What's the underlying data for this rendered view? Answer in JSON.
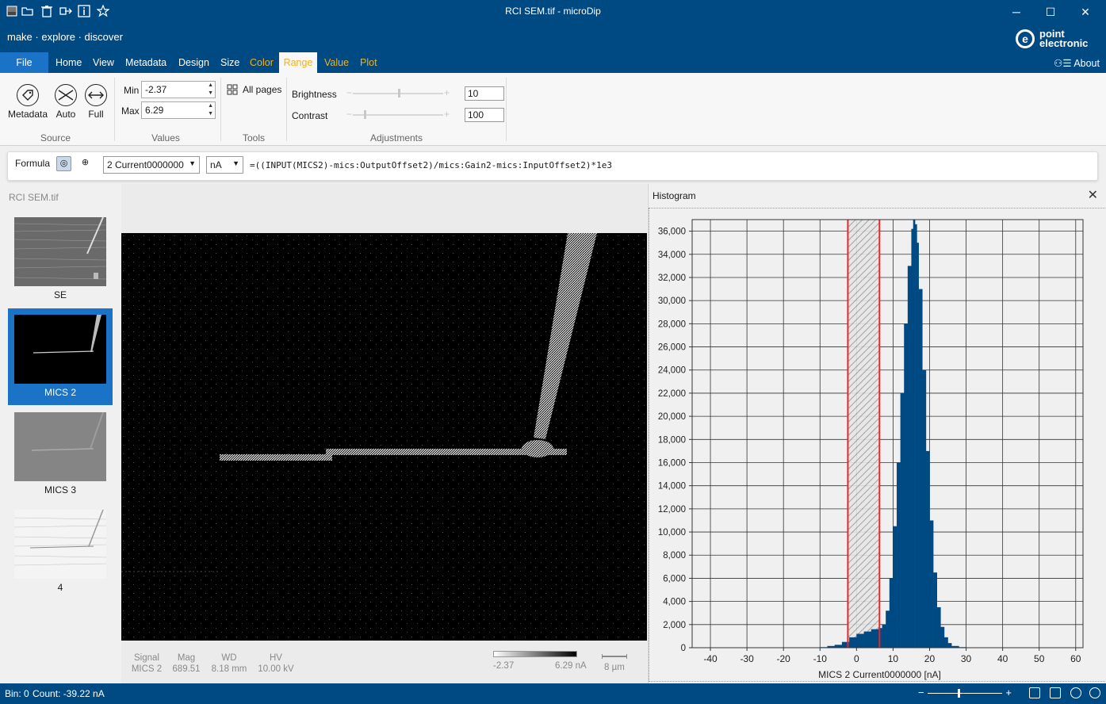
{
  "window": {
    "title": "RCI SEM.tif - microDip",
    "quick_access": [
      "image-icon",
      "open-folder-icon",
      "delete-icon",
      "export-icon",
      "info-icon",
      "star-icon"
    ],
    "controls": {
      "minimize": "─",
      "maximize": "☐",
      "close": "✕"
    }
  },
  "banner": {
    "tagline": "make · explore · discover",
    "logo_line1": "point",
    "logo_line2": "electronic",
    "logo_glyph": "e"
  },
  "tabs": [
    {
      "label": "File"
    },
    {
      "label": "Home"
    },
    {
      "label": "View"
    },
    {
      "label": "Metadata"
    },
    {
      "label": "Design"
    },
    {
      "label": "Size"
    },
    {
      "label": "Color"
    },
    {
      "label": "Range"
    },
    {
      "label": "Value"
    },
    {
      "label": "Plot"
    }
  ],
  "about": "⚇☰ About",
  "ribbon": {
    "source": {
      "label": "Source",
      "buttons": [
        {
          "label": "Metadata",
          "icon": "tag-icon"
        },
        {
          "label": "Auto",
          "icon": "auto-range-icon"
        },
        {
          "label": "Full",
          "icon": "full-range-icon"
        }
      ]
    },
    "values": {
      "label": "Values",
      "min_label": "Min",
      "min_value": "-2.37",
      "max_label": "Max",
      "max_value": "6.29"
    },
    "tools": {
      "label": "Tools",
      "all_pages": "All pages"
    },
    "adjustments": {
      "label": "Adjustments",
      "brightness_label": "Brightness",
      "brightness_value": "10",
      "contrast_label": "Contrast",
      "contrast_value": "100",
      "brightness_level": 0.5,
      "contrast_level": 0.12
    }
  },
  "formula": {
    "label": "Formula",
    "channel": "2 Current0000000",
    "unit": "nA",
    "expression": "=((INPUT(MICS2)-mics:OutputOffset2)/mics:Gain2-mics:InputOffset2)*1e3"
  },
  "thumbs": {
    "header": "RCI SEM.tif",
    "items": [
      {
        "caption": "SE",
        "selected": false
      },
      {
        "caption": "MICS 2",
        "selected": true
      },
      {
        "caption": "MICS 3",
        "selected": false
      },
      {
        "caption": "4",
        "selected": false
      }
    ]
  },
  "viewer": {
    "meta": [
      {
        "label": "Signal",
        "value": "MICS 2"
      },
      {
        "label": "Mag",
        "value": "689.51"
      },
      {
        "label": "WD",
        "value": "8.18 mm"
      },
      {
        "label": "HV",
        "value": "10.00 kV"
      }
    ],
    "scale_min": "-2.37",
    "scale_max": "6.29 nA",
    "scale_bar": "8 µm"
  },
  "histogram": {
    "title": "Histogram",
    "close": "✕"
  },
  "chart_data": {
    "type": "bar",
    "title": "",
    "xlabel": "MICS 2 Current0000000 [nA]",
    "ylabel": "",
    "xlim": [
      -45,
      62
    ],
    "ylim": [
      0,
      37000
    ],
    "x_ticks": [
      -40,
      -30,
      -20,
      -10,
      0,
      10,
      20,
      30,
      40,
      50,
      60
    ],
    "y_ticks": [
      0,
      2000,
      4000,
      6000,
      8000,
      10000,
      12000,
      14000,
      16000,
      18000,
      20000,
      22000,
      24000,
      26000,
      28000,
      30000,
      32000,
      34000,
      36000
    ],
    "y_tick_labels": [
      "0",
      "2,000",
      "4,000",
      "6,000",
      "8,000",
      "10,000",
      "12,000",
      "14,000",
      "16,000",
      "18,000",
      "20,000",
      "22,000",
      "24,000",
      "26,000",
      "28,000",
      "30,000",
      "32,000",
      "34,000",
      "36,000"
    ],
    "x_tick_labels": [
      "-40",
      "-30",
      "-20",
      "-10",
      "0",
      "10",
      "20",
      "30",
      "40",
      "50",
      "60"
    ],
    "range_selection": [
      -2.37,
      6.29
    ],
    "bins_x": [
      -10,
      -8,
      -6,
      -4,
      -2,
      0,
      2,
      4,
      6,
      7,
      8,
      9,
      10,
      11,
      12,
      13,
      14,
      15,
      15.5,
      16,
      16.5,
      17,
      18,
      19,
      20,
      21,
      22,
      23,
      24,
      25,
      26,
      28
    ],
    "bins_y": [
      50,
      150,
      250,
      500,
      900,
      1200,
      1400,
      1600,
      1700,
      2000,
      3200,
      6000,
      10500,
      16000,
      22000,
      28000,
      33000,
      36200,
      37000,
      36600,
      35000,
      31000,
      24000,
      17000,
      11000,
      6500,
      3500,
      1800,
      900,
      400,
      150,
      50
    ],
    "bar_color": "#004a84",
    "selection_color": "#e8262b"
  },
  "status": {
    "bin": "Bin: 0",
    "count": "Count: -39.22 nA",
    "zoom_level": 0.4
  }
}
